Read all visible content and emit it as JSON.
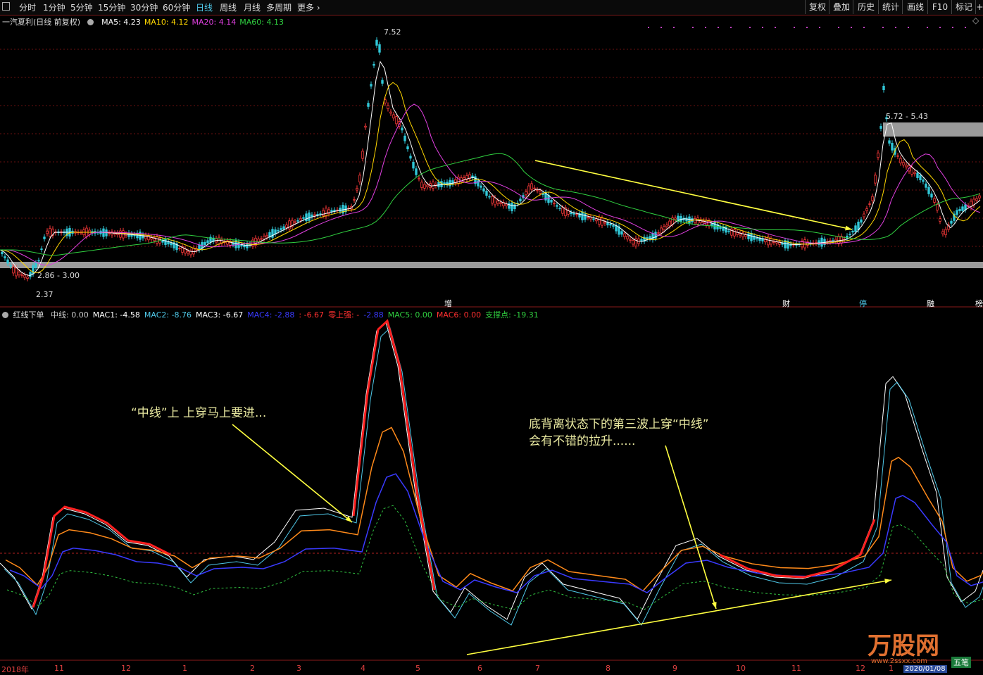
{
  "toolbar": {
    "periods": [
      "分时",
      "1分钟",
      "5分钟",
      "15分钟",
      "30分钟",
      "60分钟",
      "日线",
      "周线",
      "月线",
      "多周期",
      "更多"
    ],
    "active_period": "日线",
    "right_buttons": [
      "复权",
      "叠加",
      "历史",
      "统计",
      "画线",
      "F10",
      "标记",
      "+"
    ]
  },
  "main_panel": {
    "stock_label": "一汽夏利(日线 前复权)",
    "ma_items": [
      {
        "text": "MA5: 4.23",
        "color": "#ffffff"
      },
      {
        "text": "MA10: 4.12",
        "color": "#ffd700"
      },
      {
        "text": "MA20: 4.14",
        "color": "#e040e0"
      },
      {
        "text": "MA60: 4.13",
        "color": "#30d040"
      }
    ],
    "price_labels": {
      "high": "7.52",
      "low": "2.37",
      "zone_low": "2.86 - 3.00",
      "zone_high": "5.72 - 5.43"
    },
    "events": [
      {
        "text": "增",
        "color": "#ffffff"
      },
      {
        "text": "财",
        "color": "#ffffff"
      },
      {
        "text": "停",
        "color": "#4fc8e8"
      },
      {
        "text": "融",
        "color": "#ffffff"
      },
      {
        "text": "榜",
        "color": "#ffffff"
      }
    ]
  },
  "indicator_panel": {
    "name": "红线下单",
    "items": [
      {
        "text": "中线: 0.00",
        "color": "#cccccc"
      },
      {
        "text": "MAC1: -4.58",
        "color": "#ffffff"
      },
      {
        "text": "MAC2: -8.76",
        "color": "#4fc8e8"
      },
      {
        "text": "MAC3: -6.67",
        "color": "#ffffff"
      },
      {
        "text": "MAC4: -2.88",
        "color": "#3a3aff"
      },
      {
        "text": ": -6.67",
        "color": "#ff3030"
      },
      {
        "text": "零上强: -",
        "color": "#ff3030"
      },
      {
        "text": "-2.88",
        "color": "#3a3aff"
      },
      {
        "text": "MAC5: 0.00",
        "color": "#30d040"
      },
      {
        "text": "MAC6: 0.00",
        "color": "#ff3030"
      },
      {
        "text": "支撑点: -19.31",
        "color": "#30d040"
      }
    ]
  },
  "annotations": {
    "note1": "“中线”上 上穿马上要进...",
    "note2_line1": "底背离状态下的第三波上穿“中线”",
    "note2_line2": "会有不错的拉升......"
  },
  "time_axis": [
    "2018年",
    "11",
    "12",
    "1",
    "2",
    "3",
    "4",
    "5",
    "6",
    "7",
    "8",
    "9",
    "10",
    "11",
    "12",
    "1"
  ],
  "watermark": {
    "text": "万股网",
    "url": "www.2ssxx.com"
  },
  "status_items": [
    "2020/01/08",
    "五笔"
  ]
}
